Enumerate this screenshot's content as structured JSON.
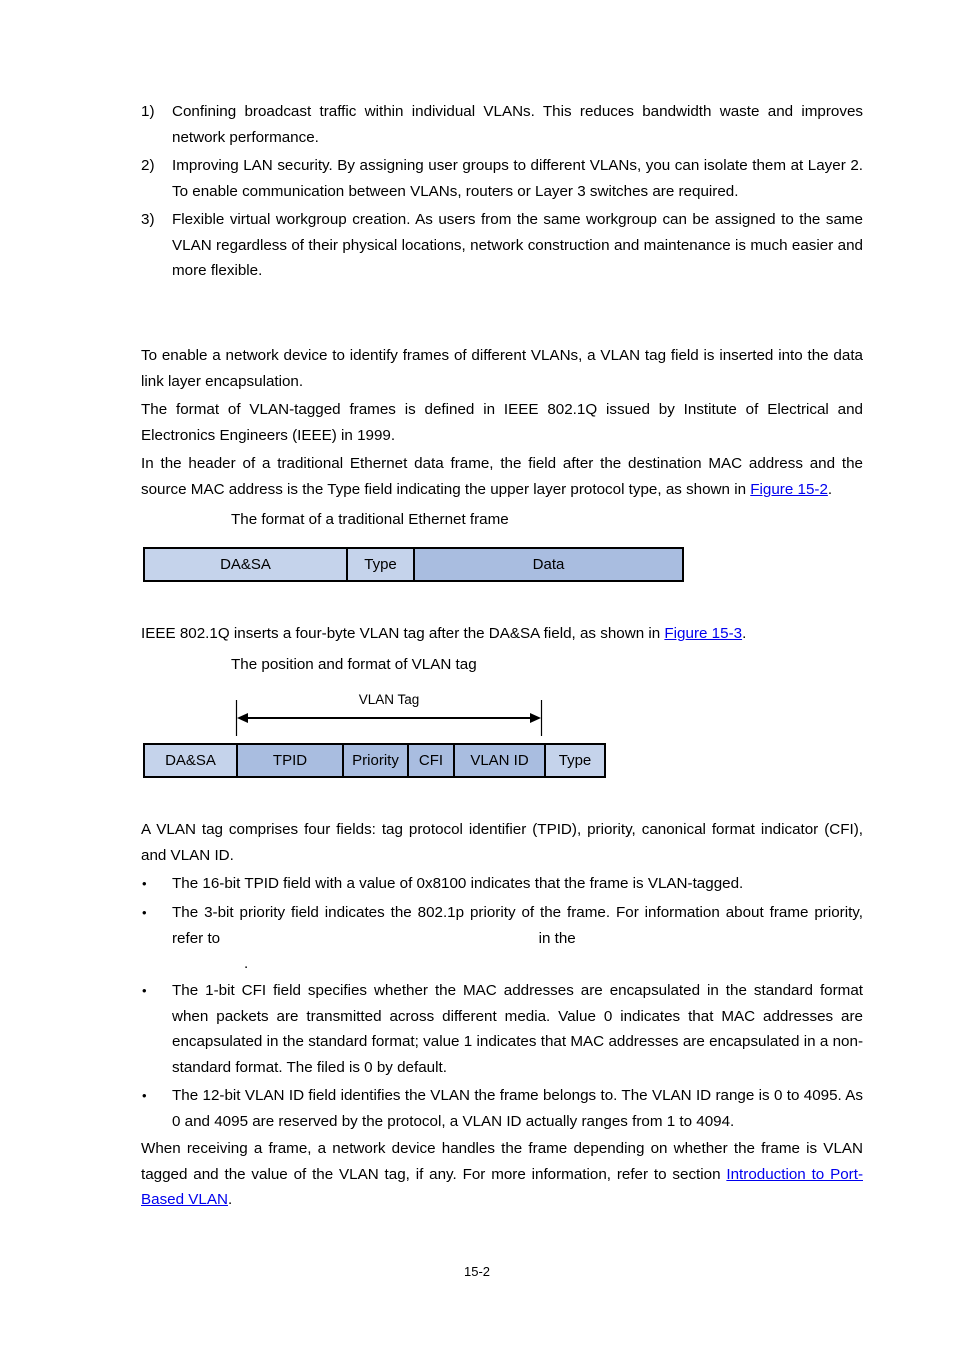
{
  "benefits_list": [
    {
      "marker": "1)",
      "text": "Confining broadcast traffic within individual VLANs. This reduces bandwidth waste and improves network performance."
    },
    {
      "marker": "2)",
      "text": "Improving LAN security. By assigning user groups to different VLANs, you can isolate them at Layer 2. To enable communication between VLANs, routers or Layer 3 switches are required."
    },
    {
      "marker": "3)",
      "text": "Flexible virtual workgroup creation. As users from the same workgroup can be assigned to the same VLAN regardless of their physical locations, network construction and maintenance is much easier and more flexible."
    }
  ],
  "intro_paragraphs": [
    "To enable a network device to identify frames of different VLANs, a VLAN tag field is inserted into the data link layer encapsulation.",
    "The format of VLAN-tagged frames is defined in IEEE 802.1Q issued by Institute of Electrical and Electronics Engineers (IEEE) in 1999."
  ],
  "traditional_para": {
    "text": "In the header of a traditional Ethernet data frame, the field after the destination MAC address and the source MAC address is the Type field indicating the upper layer protocol type, as shown in ",
    "link": "Figure 15-2",
    "suffix": "."
  },
  "figure_2": {
    "caption": "The format of a traditional Ethernet frame",
    "fields": [
      "DA&SA",
      "Type",
      "Data"
    ]
  },
  "insert_para": {
    "text": "IEEE 802.1Q inserts a four-byte VLAN tag after the DA&SA field, as shown in ",
    "link": "Figure 15-3",
    "suffix": "."
  },
  "figure_3": {
    "caption": "The position and format of VLAN tag",
    "tag_label": "VLAN Tag",
    "fields": [
      "DA&SA",
      "TPID",
      "Priority",
      "CFI",
      "VLAN ID",
      "Type"
    ]
  },
  "tag_fields_para": "A VLAN tag comprises four fields: tag protocol identifier (TPID), priority, canonical format indicator (CFI), and VLAN ID.",
  "tag_bullets": [
    {
      "marker": "•",
      "text": "The 16-bit TPID field with a value of 0x8100 indicates that the frame is VLAN-tagged."
    },
    {
      "marker": "•",
      "text_a": "The 3-bit priority field indicates the 802.1p priority of the frame. For information about frame priority, refer to",
      "text_b": "in the",
      "text_c": "."
    },
    {
      "marker": "•",
      "text": "The 1-bit CFI field specifies whether the MAC addresses are encapsulated in the standard format when packets are transmitted across different media. Value 0 indicates that MAC addresses are encapsulated in the standard format; value 1 indicates that MAC addresses are encapsulated in a non-standard format. The filed is 0 by default."
    },
    {
      "marker": "•",
      "text": "The 12-bit VLAN ID field identifies the VLAN the frame belongs to. The VLAN ID range is 0 to 4095. As 0 and 4095 are reserved by the protocol, a VLAN ID actually ranges from 1 to 4094."
    }
  ],
  "closing_para": {
    "text": "When receiving a frame, a network device handles the frame depending on whether the frame is VLAN tagged and the value of the VLAN tag, if any. For more information, refer to section ",
    "link": "Introduction to Port-Based VLAN",
    "suffix": "."
  },
  "page_number": "15-2",
  "colors": {
    "cell_light": "#c5d3eb",
    "cell_dark": "#a9bde0",
    "link": "#0000ee"
  }
}
